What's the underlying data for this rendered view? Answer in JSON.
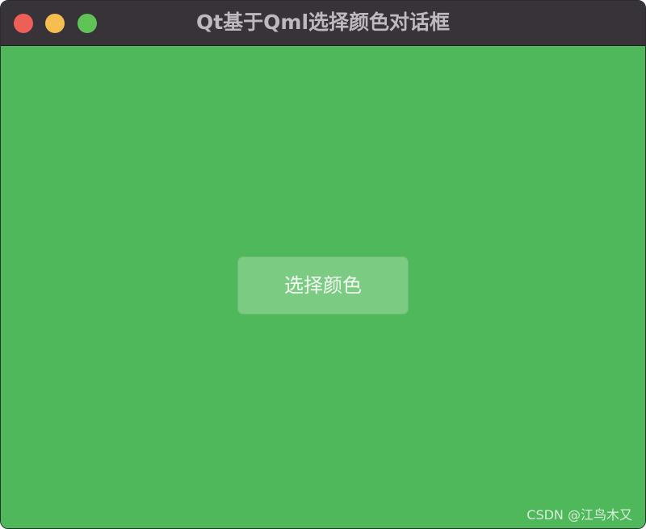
{
  "window": {
    "title": "Qt基于Qml选择颜色对话框",
    "background_color": "#4fb85a",
    "titlebar_color": "#383239"
  },
  "traffic_lights": {
    "close_color": "#ee5f57",
    "minimize_color": "#f6bd4f",
    "zoom_color": "#5fc455"
  },
  "main": {
    "button_label": "选择颜色",
    "watermark": "CSDN @江鸟木又"
  }
}
